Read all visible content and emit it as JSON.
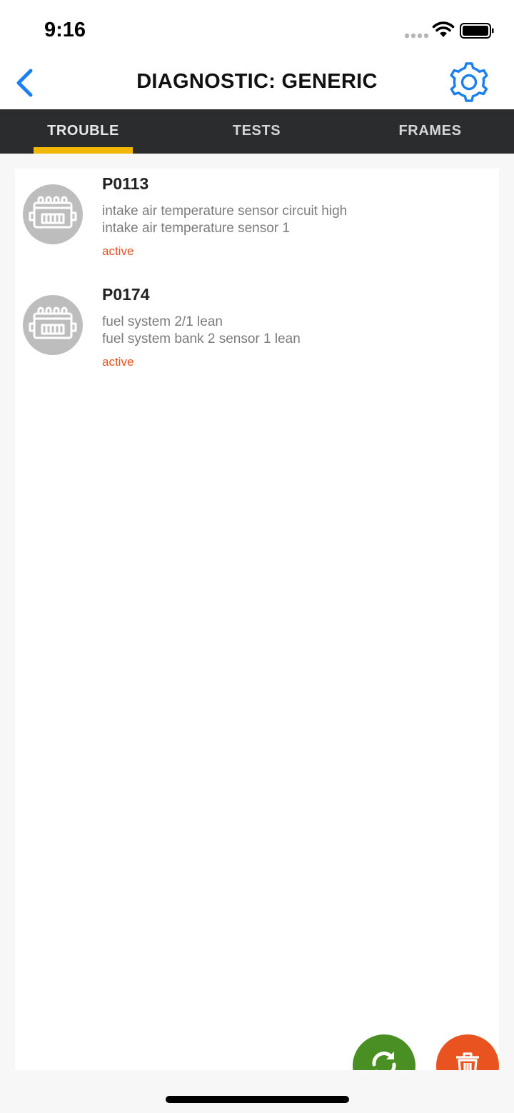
{
  "status_bar": {
    "time": "9:16"
  },
  "nav": {
    "title": "DIAGNOSTIC: GENERIC",
    "back_icon": "chevron-left-icon",
    "settings_icon": "gear-icon"
  },
  "tabs": [
    {
      "label": "TROUBLE",
      "active": true
    },
    {
      "label": "TESTS",
      "active": false
    },
    {
      "label": "FRAMES",
      "active": false
    }
  ],
  "trouble_codes": [
    {
      "code": "P0113",
      "line1": "intake air temperature sensor circuit high",
      "line2": "intake air temperature sensor 1",
      "status": "active",
      "icon": "engine-module-icon"
    },
    {
      "code": "P0174",
      "line1": "fuel system 2/1 lean",
      "line2": "fuel system bank 2 sensor 1 lean",
      "status": "active",
      "icon": "engine-module-icon"
    }
  ],
  "actions": {
    "refresh_icon": "refresh-icon",
    "delete_icon": "trash-icon"
  },
  "colors": {
    "accent_blue": "#1a7ff0",
    "tab_bar": "#2b2c2e",
    "tab_indicator": "#f2b705",
    "status_active": "#e8531f",
    "refresh_green": "#4a8f24",
    "delete_orange": "#e8531f"
  }
}
